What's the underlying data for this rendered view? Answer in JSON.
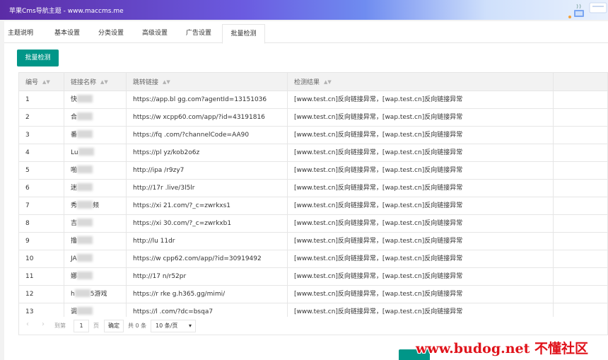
{
  "window": {
    "title": "苹果Cms导航主题 - www.maccms.me"
  },
  "tabs": [
    {
      "label": "主题说明"
    },
    {
      "label": "基本设置"
    },
    {
      "label": "分类设置"
    },
    {
      "label": "高级设置"
    },
    {
      "label": "广告设置"
    },
    {
      "label": "批量检测",
      "active": true
    }
  ],
  "toolbar": {
    "batch_check_label": "批量检测"
  },
  "table": {
    "columns": [
      "编号",
      "链接名称",
      "跳转链接",
      "检测结果"
    ],
    "rows": [
      {
        "id": "1",
        "name_start": "快",
        "name_end": "",
        "url": "https://app.bl  gg.com?agentId=13151036",
        "result": "[www.test.cn]反向链接异常，[wap.test.cn]反向链接异常"
      },
      {
        "id": "2",
        "name_start": "合",
        "name_end": "",
        "url": "https://w  xcpp60.com/app/?id=43191816",
        "result": "[www.test.cn]反向链接异常，[wap.test.cn]反向链接异常"
      },
      {
        "id": "3",
        "name_start": "番",
        "name_end": "",
        "url": "https://fq  .com/?channelCode=AA90",
        "result": "[www.test.cn]反向链接异常，[wap.test.cn]反向链接异常"
      },
      {
        "id": "4",
        "name_start": "Lu",
        "name_end": "",
        "url": "https://pl  yz/kob2o6z",
        "result": "[www.test.cn]反向链接异常，[wap.test.cn]反向链接异常"
      },
      {
        "id": "5",
        "name_start": "啪",
        "name_end": "",
        "url": "http://ipa  /r9zy7",
        "result": "[www.test.cn]反向链接异常，[wap.test.cn]反向链接异常"
      },
      {
        "id": "6",
        "name_start": "迷",
        "name_end": "",
        "url": "http://17r  .live/3l5lr",
        "result": "[www.test.cn]反向链接异常，[wap.test.cn]反向链接异常"
      },
      {
        "id": "7",
        "name_start": "秀",
        "name_end": "频",
        "url": "https://xi  21.com/?_c=zwrkxs1",
        "result": "[www.test.cn]反向链接异常，[wap.test.cn]反向链接异常"
      },
      {
        "id": "8",
        "name_start": "吉",
        "name_end": "",
        "url": "https://xi  30.com/?_c=zwrkxb1",
        "result": "[www.test.cn]反向链接异常，[wap.test.cn]反向链接异常"
      },
      {
        "id": "9",
        "name_start": "撸",
        "name_end": "",
        "url": "http://lu  11dr",
        "result": "[www.test.cn]反向链接异常，[wap.test.cn]反向链接异常"
      },
      {
        "id": "10",
        "name_start": "JA",
        "name_end": "",
        "url": "https://w  cpp62.com/app/?id=30919492",
        "result": "[www.test.cn]反向链接异常，[wap.test.cn]反向链接异常"
      },
      {
        "id": "11",
        "name_start": "娜",
        "name_end": "",
        "url": "http://17  n/r52pr",
        "result": "[www.test.cn]反向链接异常，[wap.test.cn]反向链接异常"
      },
      {
        "id": "12",
        "name_start": "h",
        "name_end": "5游戏",
        "url": "https://r  rke  g.h365.gg/mimi/",
        "result": "[www.test.cn]反向链接异常，[wap.test.cn]反向链接异常"
      },
      {
        "id": "13",
        "name_start": "调",
        "name_end": "",
        "url": "https://l  .com/?dc=bsqa7",
        "result": "[www.test.cn]反向链接异常，[wap.test.cn]反向链接异常"
      }
    ]
  },
  "pagination": {
    "prev_icon": "chevron-left-icon",
    "next_icon": "chevron-right-icon",
    "goto_label": "到第",
    "page_value": "1",
    "page_unit": "页",
    "confirm_label": "确定",
    "total_label": "共 0 条",
    "page_size_value": "10 条/页"
  },
  "watermark": {
    "text": "www.budog.net 不懂社区"
  },
  "colors": {
    "primary": "#009688",
    "watermark": "#e0121a"
  }
}
